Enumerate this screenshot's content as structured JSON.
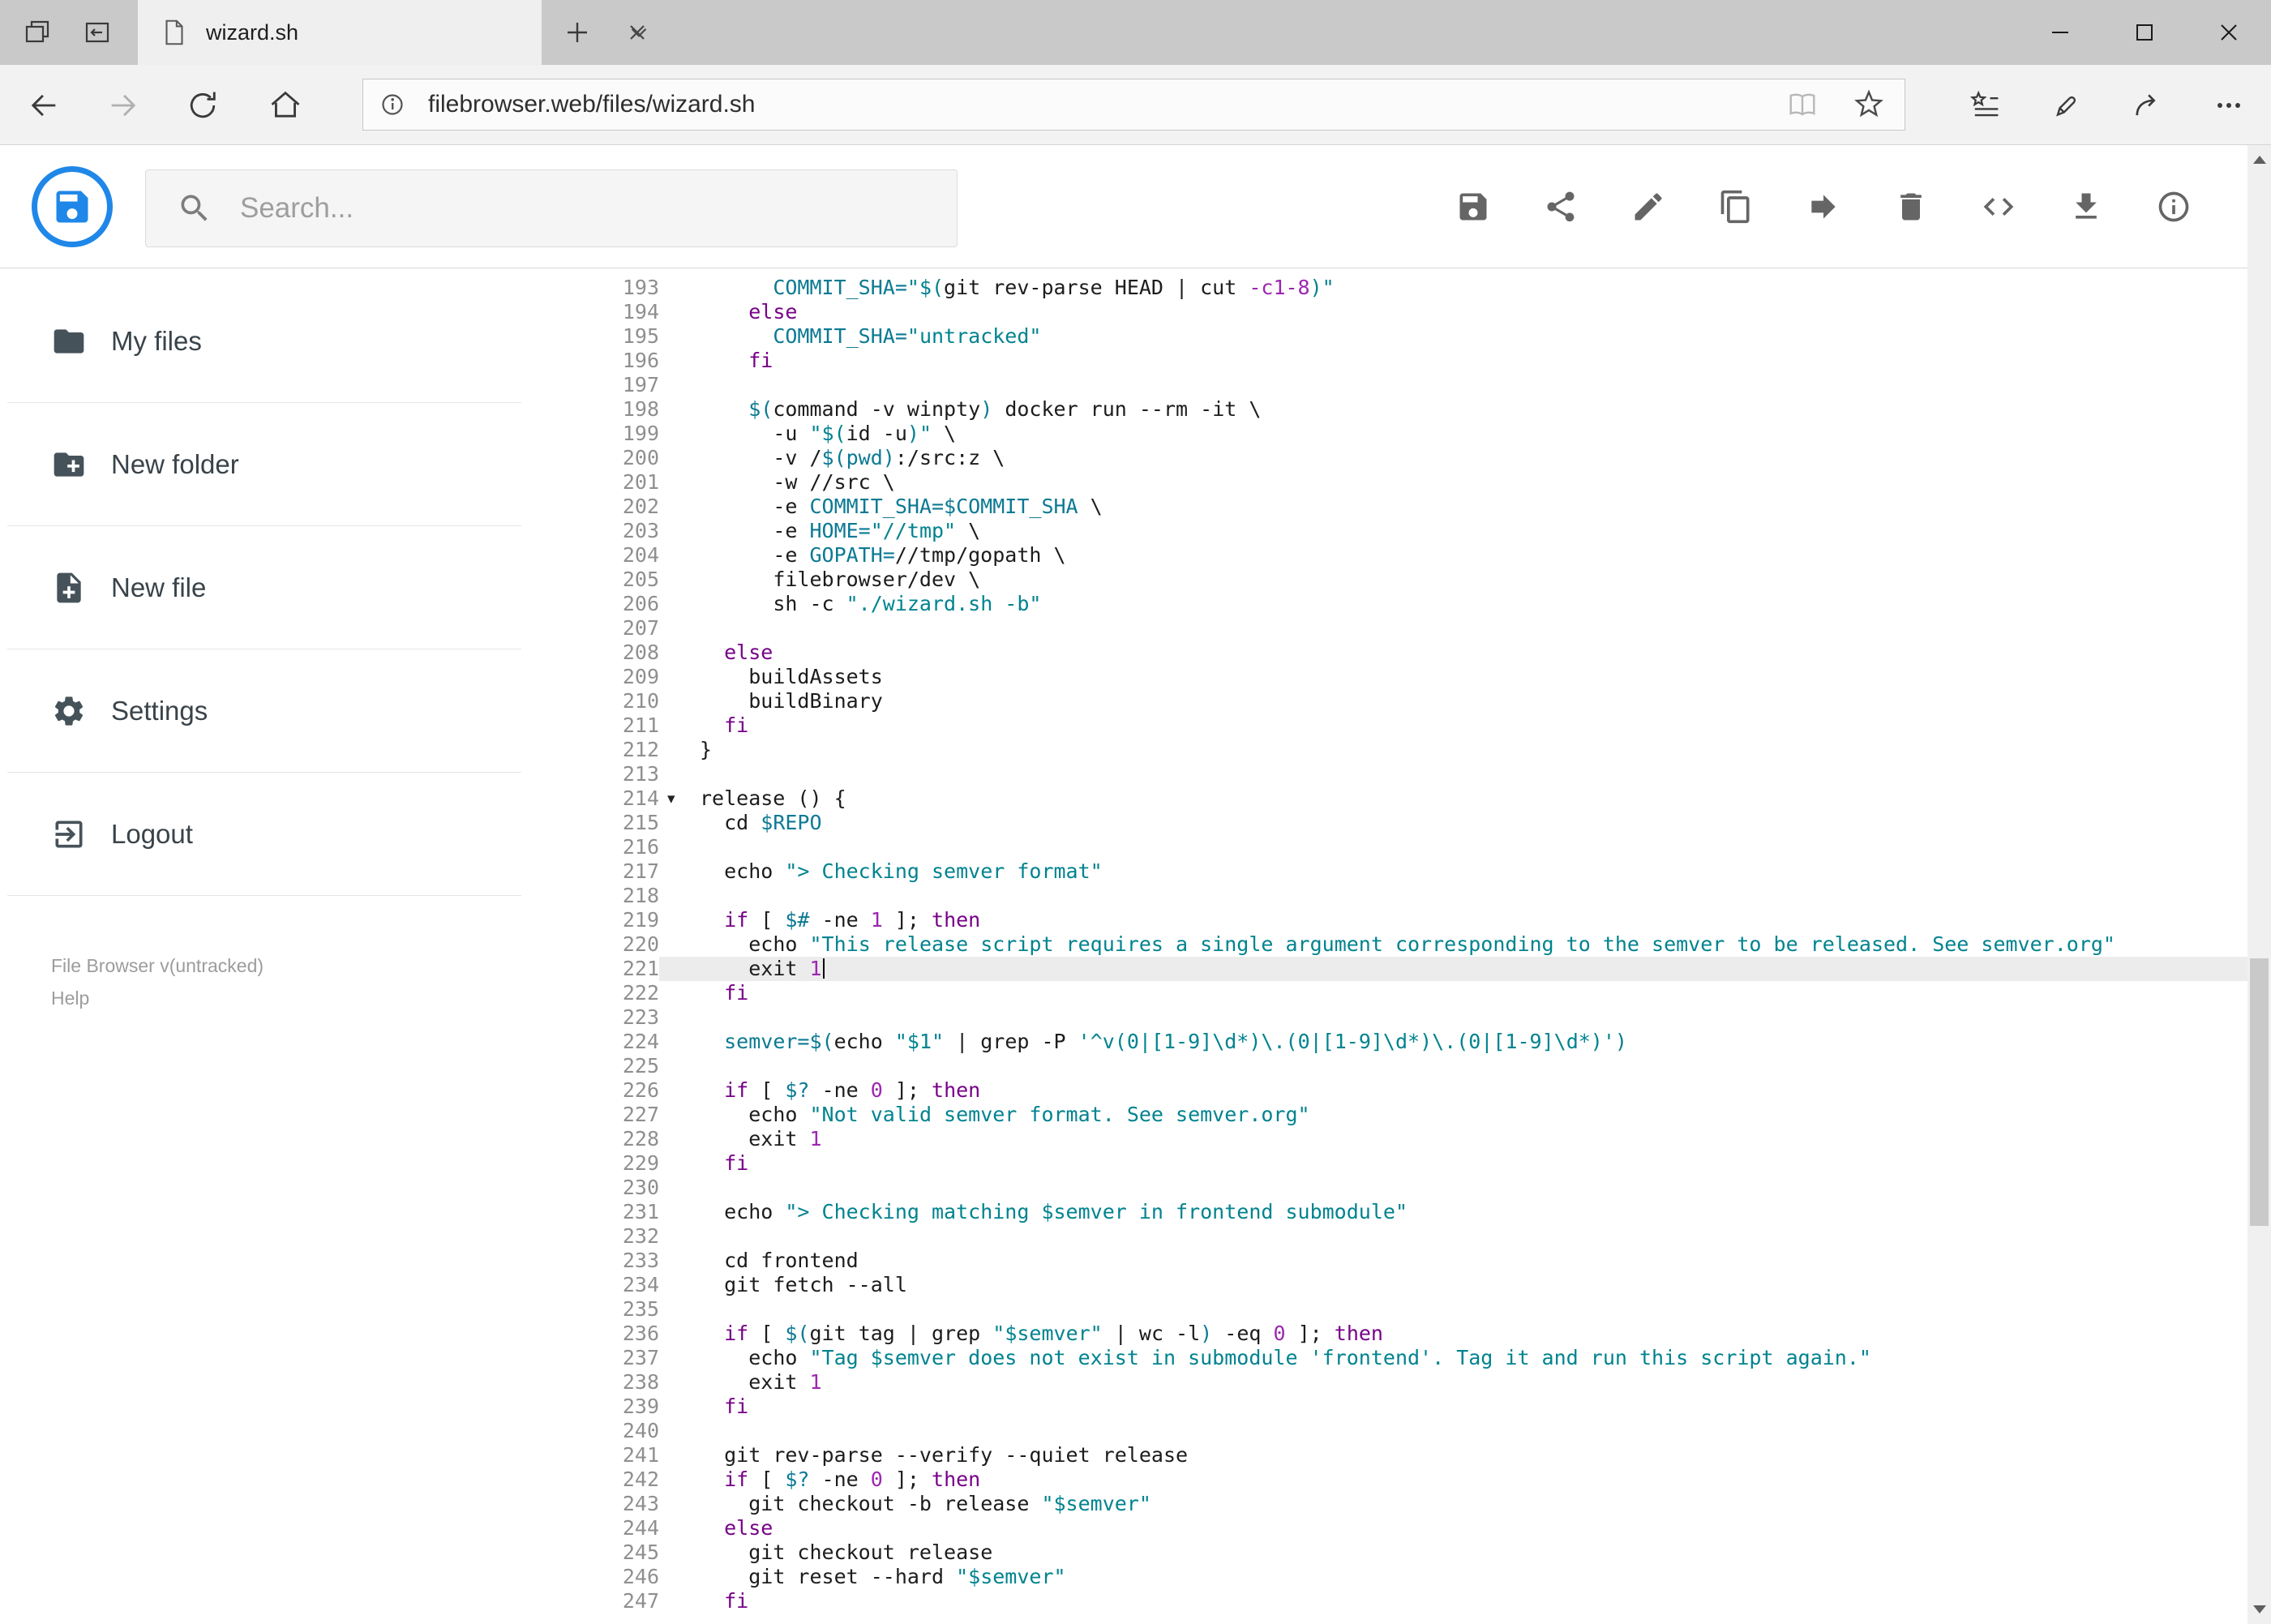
{
  "window": {
    "controls": {
      "minimize": "minimize",
      "maximize": "maximize",
      "close": "close"
    }
  },
  "browser": {
    "tab_title": "wizard.sh",
    "url": "filebrowser.web/files/wizard.sh",
    "nav_icons": [
      "back",
      "forward",
      "refresh",
      "home",
      "site-info",
      "reading-view",
      "favorite-star",
      "hub",
      "web-note-pen",
      "share",
      "more"
    ]
  },
  "app": {
    "search_placeholder": "Search...",
    "toolbar_icons": [
      "save",
      "share",
      "rename",
      "copy",
      "move",
      "delete",
      "raw-code",
      "download",
      "info"
    ],
    "sidebar": {
      "items": [
        {
          "label": "My files",
          "icon": "folder"
        },
        {
          "label": "New folder",
          "icon": "create-new-folder"
        },
        {
          "label": "New file",
          "icon": "note-add"
        },
        {
          "label": "Settings",
          "icon": "gear"
        },
        {
          "label": "Logout",
          "icon": "exit"
        }
      ],
      "version": "File Browser v(untracked)",
      "help": "Help"
    }
  },
  "colors": {
    "accent_blue": "#1f87e8",
    "active_line": "#ececec",
    "syntax_keyword": "#770088",
    "syntax_string": "#00838f",
    "syntax_variable": "#0c7a93",
    "syntax_number": "#9c27b0"
  },
  "editor": {
    "active_line": 221,
    "cursor_line": 221,
    "fold_lines": [
      214
    ],
    "lines": [
      {
        "n": 193,
        "s": [
          [
            "",
            "      "
          ],
          [
            "v",
            "COMMIT_SHA="
          ],
          [
            "s",
            "\"$("
          ],
          [
            "",
            "git rev-parse HEAD | cut "
          ],
          [
            "n",
            "-c1-8"
          ],
          [
            "s",
            ")\""
          ]
        ]
      },
      {
        "n": 194,
        "s": [
          [
            "",
            "    "
          ],
          [
            "k",
            "else"
          ]
        ]
      },
      {
        "n": 195,
        "s": [
          [
            "",
            "      "
          ],
          [
            "v",
            "COMMIT_SHA="
          ],
          [
            "s",
            "\"untracked\""
          ]
        ]
      },
      {
        "n": 196,
        "s": [
          [
            "",
            "    "
          ],
          [
            "k",
            "fi"
          ]
        ]
      },
      {
        "n": 197,
        "s": []
      },
      {
        "n": 198,
        "s": [
          [
            "",
            "    "
          ],
          [
            "v",
            "$("
          ],
          [
            "",
            "command -v winpty"
          ],
          [
            "v",
            ")"
          ],
          [
            "",
            " docker run --rm -it \\"
          ]
        ]
      },
      {
        "n": 199,
        "s": [
          [
            "",
            "      "
          ],
          [
            "",
            "-u "
          ],
          [
            "s",
            "\"$("
          ],
          [
            "",
            "id -u"
          ],
          [
            "s",
            ")\""
          ],
          [
            "",
            " \\"
          ]
        ]
      },
      {
        "n": 200,
        "s": [
          [
            "",
            "      "
          ],
          [
            "",
            "-v /"
          ],
          [
            "v",
            "$(pwd)"
          ],
          [
            "",
            ":/src:z \\"
          ]
        ]
      },
      {
        "n": 201,
        "s": [
          [
            "",
            "      "
          ],
          [
            "",
            "-w //src \\"
          ]
        ]
      },
      {
        "n": 202,
        "s": [
          [
            "",
            "      "
          ],
          [
            "",
            "-e "
          ],
          [
            "v",
            "COMMIT_SHA=$COMMIT_SHA"
          ],
          [
            "",
            " \\"
          ]
        ]
      },
      {
        "n": 203,
        "s": [
          [
            "",
            "      "
          ],
          [
            "",
            "-e "
          ],
          [
            "v",
            "HOME="
          ],
          [
            "s",
            "\"//tmp\""
          ],
          [
            "",
            " \\"
          ]
        ]
      },
      {
        "n": 204,
        "s": [
          [
            "",
            "      "
          ],
          [
            "",
            "-e "
          ],
          [
            "v",
            "GOPATH="
          ],
          [
            "",
            "//tmp/gopath \\"
          ]
        ]
      },
      {
        "n": 205,
        "s": [
          [
            "",
            "      "
          ],
          [
            "",
            "filebrowser/dev \\"
          ]
        ]
      },
      {
        "n": 206,
        "s": [
          [
            "",
            "      "
          ],
          [
            "",
            "sh -c "
          ],
          [
            "s",
            "\"./wizard.sh -b\""
          ]
        ]
      },
      {
        "n": 207,
        "s": []
      },
      {
        "n": 208,
        "s": [
          [
            "",
            "  "
          ],
          [
            "k",
            "else"
          ]
        ]
      },
      {
        "n": 209,
        "s": [
          [
            "",
            "    "
          ],
          [
            "",
            "buildAssets"
          ]
        ]
      },
      {
        "n": 210,
        "s": [
          [
            "",
            "    "
          ],
          [
            "",
            "buildBinary"
          ]
        ]
      },
      {
        "n": 211,
        "s": [
          [
            "",
            "  "
          ],
          [
            "k",
            "fi"
          ]
        ]
      },
      {
        "n": 212,
        "s": [
          [
            "",
            "}"
          ]
        ]
      },
      {
        "n": 213,
        "s": []
      },
      {
        "n": 214,
        "s": [
          [
            "",
            "release () {"
          ]
        ]
      },
      {
        "n": 215,
        "s": [
          [
            "",
            "  "
          ],
          [
            "",
            "cd "
          ],
          [
            "v",
            "$REPO"
          ]
        ]
      },
      {
        "n": 216,
        "s": []
      },
      {
        "n": 217,
        "s": [
          [
            "",
            "  "
          ],
          [
            "",
            "echo "
          ],
          [
            "s",
            "\"> Checking semver format\""
          ]
        ]
      },
      {
        "n": 218,
        "s": []
      },
      {
        "n": 219,
        "s": [
          [
            "",
            "  "
          ],
          [
            "k",
            "if"
          ],
          [
            "",
            " [ "
          ],
          [
            "v",
            "$#"
          ],
          [
            "",
            " -ne "
          ],
          [
            "n",
            "1"
          ],
          [
            "",
            " ]; "
          ],
          [
            "k",
            "then"
          ]
        ]
      },
      {
        "n": 220,
        "s": [
          [
            "",
            "    "
          ],
          [
            "",
            "echo "
          ],
          [
            "s",
            "\"This release script requires a single argument corresponding to the semver to be released. See semver.org\""
          ]
        ]
      },
      {
        "n": 221,
        "s": [
          [
            "",
            "    "
          ],
          [
            "",
            "exit "
          ],
          [
            "n",
            "1"
          ]
        ]
      },
      {
        "n": 222,
        "s": [
          [
            "",
            "  "
          ],
          [
            "k",
            "fi"
          ]
        ]
      },
      {
        "n": 223,
        "s": []
      },
      {
        "n": 224,
        "s": [
          [
            "",
            "  "
          ],
          [
            "v",
            "semver=$("
          ],
          [
            "",
            "echo "
          ],
          [
            "s",
            "\"$1\""
          ],
          [
            "",
            " | grep -P "
          ],
          [
            "s",
            "'^v(0|[1-9]\\d*)\\.(0|[1-9]\\d*)\\.(0|[1-9]\\d*)'"
          ],
          [
            "v",
            ")"
          ]
        ]
      },
      {
        "n": 225,
        "s": []
      },
      {
        "n": 226,
        "s": [
          [
            "",
            "  "
          ],
          [
            "k",
            "if"
          ],
          [
            "",
            " [ "
          ],
          [
            "v",
            "$?"
          ],
          [
            "",
            " -ne "
          ],
          [
            "n",
            "0"
          ],
          [
            "",
            " ]; "
          ],
          [
            "k",
            "then"
          ]
        ]
      },
      {
        "n": 227,
        "s": [
          [
            "",
            "    "
          ],
          [
            "",
            "echo "
          ],
          [
            "s",
            "\"Not valid semver format. See semver.org\""
          ]
        ]
      },
      {
        "n": 228,
        "s": [
          [
            "",
            "    "
          ],
          [
            "",
            "exit "
          ],
          [
            "n",
            "1"
          ]
        ]
      },
      {
        "n": 229,
        "s": [
          [
            "",
            "  "
          ],
          [
            "k",
            "fi"
          ]
        ]
      },
      {
        "n": 230,
        "s": []
      },
      {
        "n": 231,
        "s": [
          [
            "",
            "  "
          ],
          [
            "",
            "echo "
          ],
          [
            "s",
            "\"> Checking matching $semver in frontend submodule\""
          ]
        ]
      },
      {
        "n": 232,
        "s": []
      },
      {
        "n": 233,
        "s": [
          [
            "",
            "  "
          ],
          [
            "",
            "cd frontend"
          ]
        ]
      },
      {
        "n": 234,
        "s": [
          [
            "",
            "  "
          ],
          [
            "",
            "git fetch --all"
          ]
        ]
      },
      {
        "n": 235,
        "s": []
      },
      {
        "n": 236,
        "s": [
          [
            "",
            "  "
          ],
          [
            "k",
            "if"
          ],
          [
            "",
            " [ "
          ],
          [
            "v",
            "$("
          ],
          [
            "",
            "git tag | grep "
          ],
          [
            "s",
            "\"$semver\""
          ],
          [
            "",
            " | wc -l"
          ],
          [
            "v",
            ")"
          ],
          [
            "",
            " -eq "
          ],
          [
            "n",
            "0"
          ],
          [
            "",
            " ]; "
          ],
          [
            "k",
            "then"
          ]
        ]
      },
      {
        "n": 237,
        "s": [
          [
            "",
            "    "
          ],
          [
            "",
            "echo "
          ],
          [
            "s",
            "\"Tag $semver does not exist in submodule 'frontend'. Tag it and run this script again.\""
          ]
        ]
      },
      {
        "n": 238,
        "s": [
          [
            "",
            "    "
          ],
          [
            "",
            "exit "
          ],
          [
            "n",
            "1"
          ]
        ]
      },
      {
        "n": 239,
        "s": [
          [
            "",
            "  "
          ],
          [
            "k",
            "fi"
          ]
        ]
      },
      {
        "n": 240,
        "s": []
      },
      {
        "n": 241,
        "s": [
          [
            "",
            "  "
          ],
          [
            "",
            "git rev-parse --verify --quiet release"
          ]
        ]
      },
      {
        "n": 242,
        "s": [
          [
            "",
            "  "
          ],
          [
            "k",
            "if"
          ],
          [
            "",
            " [ "
          ],
          [
            "v",
            "$?"
          ],
          [
            "",
            " -ne "
          ],
          [
            "n",
            "0"
          ],
          [
            "",
            " ]; "
          ],
          [
            "k",
            "then"
          ]
        ]
      },
      {
        "n": 243,
        "s": [
          [
            "",
            "    "
          ],
          [
            "",
            "git checkout -b release "
          ],
          [
            "s",
            "\"$semver\""
          ]
        ]
      },
      {
        "n": 244,
        "s": [
          [
            "",
            "  "
          ],
          [
            "k",
            "else"
          ]
        ]
      },
      {
        "n": 245,
        "s": [
          [
            "",
            "    "
          ],
          [
            "",
            "git checkout release"
          ]
        ]
      },
      {
        "n": 246,
        "s": [
          [
            "",
            "    "
          ],
          [
            "",
            "git reset --hard "
          ],
          [
            "s",
            "\"$semver\""
          ]
        ]
      },
      {
        "n": 247,
        "s": [
          [
            "",
            "  "
          ],
          [
            "k",
            "fi"
          ]
        ]
      }
    ]
  }
}
